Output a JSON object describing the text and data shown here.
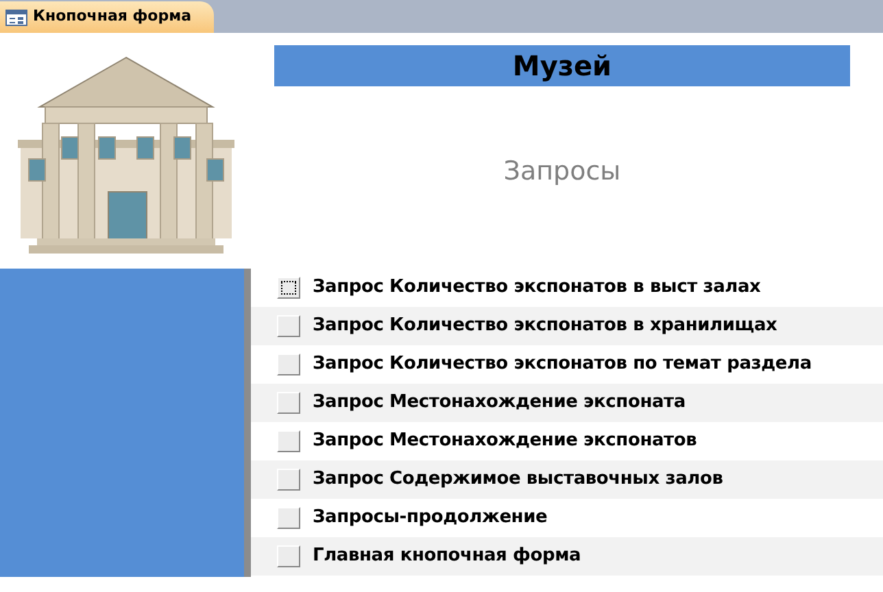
{
  "tab": {
    "title": "Кнопочная форма",
    "selected": true
  },
  "header": {
    "title": "Музей",
    "subtitle": "Запросы"
  },
  "items": [
    {
      "label": "Запрос Количество экспонатов в выст залах",
      "focused": true
    },
    {
      "label": "Запрос Количество экспонатов в хранилищах",
      "focused": false
    },
    {
      "label": "Запрос Количество экспонатов по темат раздела",
      "focused": false
    },
    {
      "label": "Запрос Местонахождение экспоната",
      "focused": false
    },
    {
      "label": "Запрос Местонахождение экспонатов",
      "focused": false
    },
    {
      "label": "Запрос Содержимое выставочных залов",
      "focused": false
    },
    {
      "label": "Запросы-продолжение",
      "focused": false
    },
    {
      "label": "Главная кнопочная форма",
      "focused": false
    }
  ]
}
